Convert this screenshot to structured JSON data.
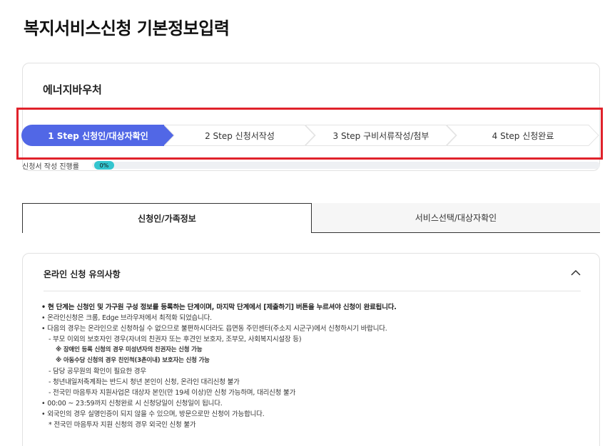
{
  "page": {
    "title": "복지서비스신청 기본정보입력"
  },
  "voucher": {
    "title": "에너지바우처"
  },
  "steps": [
    {
      "label": "1 Step 신청인/대상자확인",
      "active": true
    },
    {
      "label": "2 Step 신청서작성",
      "active": false
    },
    {
      "label": "3 Step 구비서류작성/첨부",
      "active": false
    },
    {
      "label": "4 Step 신청완료",
      "active": false
    }
  ],
  "progress": {
    "label": "신청서 작성 진행률",
    "value_text": "0%",
    "percent": 0
  },
  "tabs": [
    {
      "label": "신청인/가족정보",
      "active": true
    },
    {
      "label": "서비스선택/대상자확인",
      "active": false
    }
  ],
  "notice": {
    "title": "온라인 신청 유의사항",
    "lines": [
      "• 현 단계는 신청인 및 가구원 구성 정보를 등록하는 단계이며, 마지막 단계에서 [제출하기] 버튼을 누르셔야 신청이 완료됩니다.",
      "• 온라인신청은 크롬, Edge 브라우저에서 최적화 되었습니다.",
      "• 다음의 경우는 온라인으로 신청하실 수 없으므로 불편하시더라도 읍면동 주민센터(주소지 시군구)에서 신청하시기 바랍니다.",
      "- 부모 이외의 보호자인 경우(자녀의 친권자 또는 후견인 보호자, 조부모, 사회복지시설장 등)",
      "※ 장애인 등록 신청의 경우 미성년자의 친권자는 신청 가능",
      "※ 아동수당 신청의 경우 친인척(3촌이내) 보호자는 신청 가능",
      "- 담당 공무원의 확인이 필요한 경우",
      "- 청년내일저축계좌는 반드시 청년 본인이 신청, 온라인 대리신청 불가",
      "- 전국민 마음투자 지원사업은 대상자 본인(만 19세 이상)만 신청 가능하며, 대리신청 불가",
      "• 00:00 ~ 23:59까지 신청완료 시 신청당일이 신청일이 됩니다.",
      "• 외국인의 경우 실명인증이 되지 않을 수 있으며, 방문으로만 신청이 가능합니다.",
      "* 전국민 마음투자 지원 신청의 경우 외국인 신청 불가"
    ]
  },
  "colors": {
    "step_active": "#5167e6",
    "highlight": "#e0222b",
    "progress": "#34c5cf"
  },
  "icons": {
    "collapse": "chevron-up-icon"
  }
}
